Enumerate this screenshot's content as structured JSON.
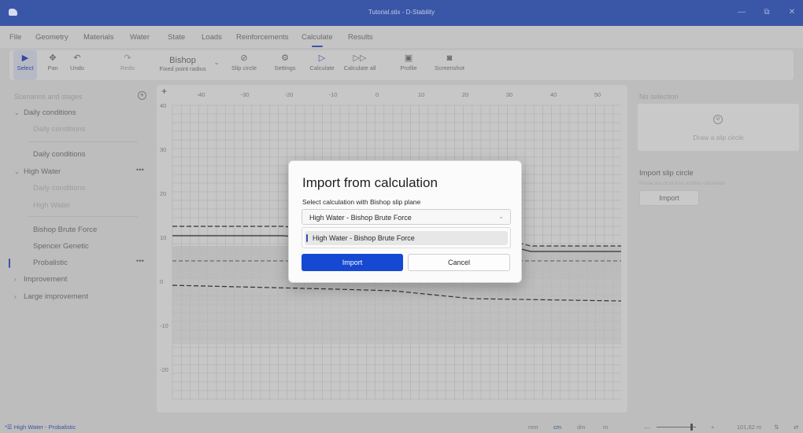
{
  "window": {
    "title": "Tutorial.stix - D-Stability",
    "app_icon": "d-stability-logo-icon",
    "controls": {
      "minimize": "—",
      "maximize": "⧉",
      "close": "✕"
    }
  },
  "menu": [
    "File",
    "Geometry",
    "Materials",
    "Water",
    "State",
    "Loads",
    "Reinforcements",
    "Calculate",
    "Results"
  ],
  "menu_active": "Calculate",
  "toolbar": {
    "select": "Select",
    "pan": "Pan",
    "undo": "Undo",
    "redo": "Redo",
    "method": "Bishop",
    "method_sub": "Fixed point radius",
    "slip_circle": "Slip circle",
    "settings": "Settings",
    "calculate": "Calculate",
    "calculate_all": "Calculate all",
    "profile": "Profile",
    "screenshot": "Screenshot"
  },
  "scenarios": {
    "header": "Scenarios and stages",
    "items": [
      {
        "label": "Daily conditions",
        "kind": "scenario",
        "expanded": true
      },
      {
        "label": "Daily conditions",
        "kind": "stage-dim"
      },
      {
        "label": "Daily conditions",
        "kind": "calc"
      },
      {
        "label": "High Water",
        "kind": "scenario",
        "expanded": true,
        "more": "•••"
      },
      {
        "label": "Daily conditions",
        "kind": "stage-dim"
      },
      {
        "label": "High Water",
        "kind": "stage-dim"
      },
      {
        "label": "Bishop Brute Force",
        "kind": "calc"
      },
      {
        "label": "Spencer Genetic",
        "kind": "calc"
      },
      {
        "label": "Probalistic",
        "kind": "calc-selected",
        "more": "•••"
      },
      {
        "label": "Improvement",
        "kind": "scenario",
        "expanded": false
      },
      {
        "label": "Large improvement",
        "kind": "scenario",
        "expanded": false
      }
    ]
  },
  "canvas": {
    "x_ticks": [
      "-40",
      "-30",
      "-20",
      "-10",
      "0",
      "10",
      "20",
      "30",
      "40",
      "50"
    ],
    "y_ticks": [
      "40",
      "30",
      "20",
      "10",
      "0",
      "-10",
      "-20"
    ],
    "plus": "+"
  },
  "right_panel": {
    "header": "No selection",
    "draw_label": "Draw a slip circle",
    "import_title": "Import slip circle",
    "import_sub": "Reuse slip circle from another calculation",
    "import_button": "Import"
  },
  "statusbar": {
    "left": "High Water - Probalistic",
    "units": [
      "mm",
      "cm",
      "dm",
      "m"
    ],
    "unit_active": "cm",
    "zoom_minus": "—",
    "zoom_plus": "+",
    "zoom_value": "101,62 m",
    "zoom_fraction": 0.85
  },
  "dialog": {
    "title": "Import from calculation",
    "label": "Select calculation with Bishop slip plane",
    "selected": "High Water - Bishop Brute Force",
    "options": [
      "High Water - Bishop Brute Force"
    ],
    "primary": "Import",
    "secondary": "Cancel"
  }
}
